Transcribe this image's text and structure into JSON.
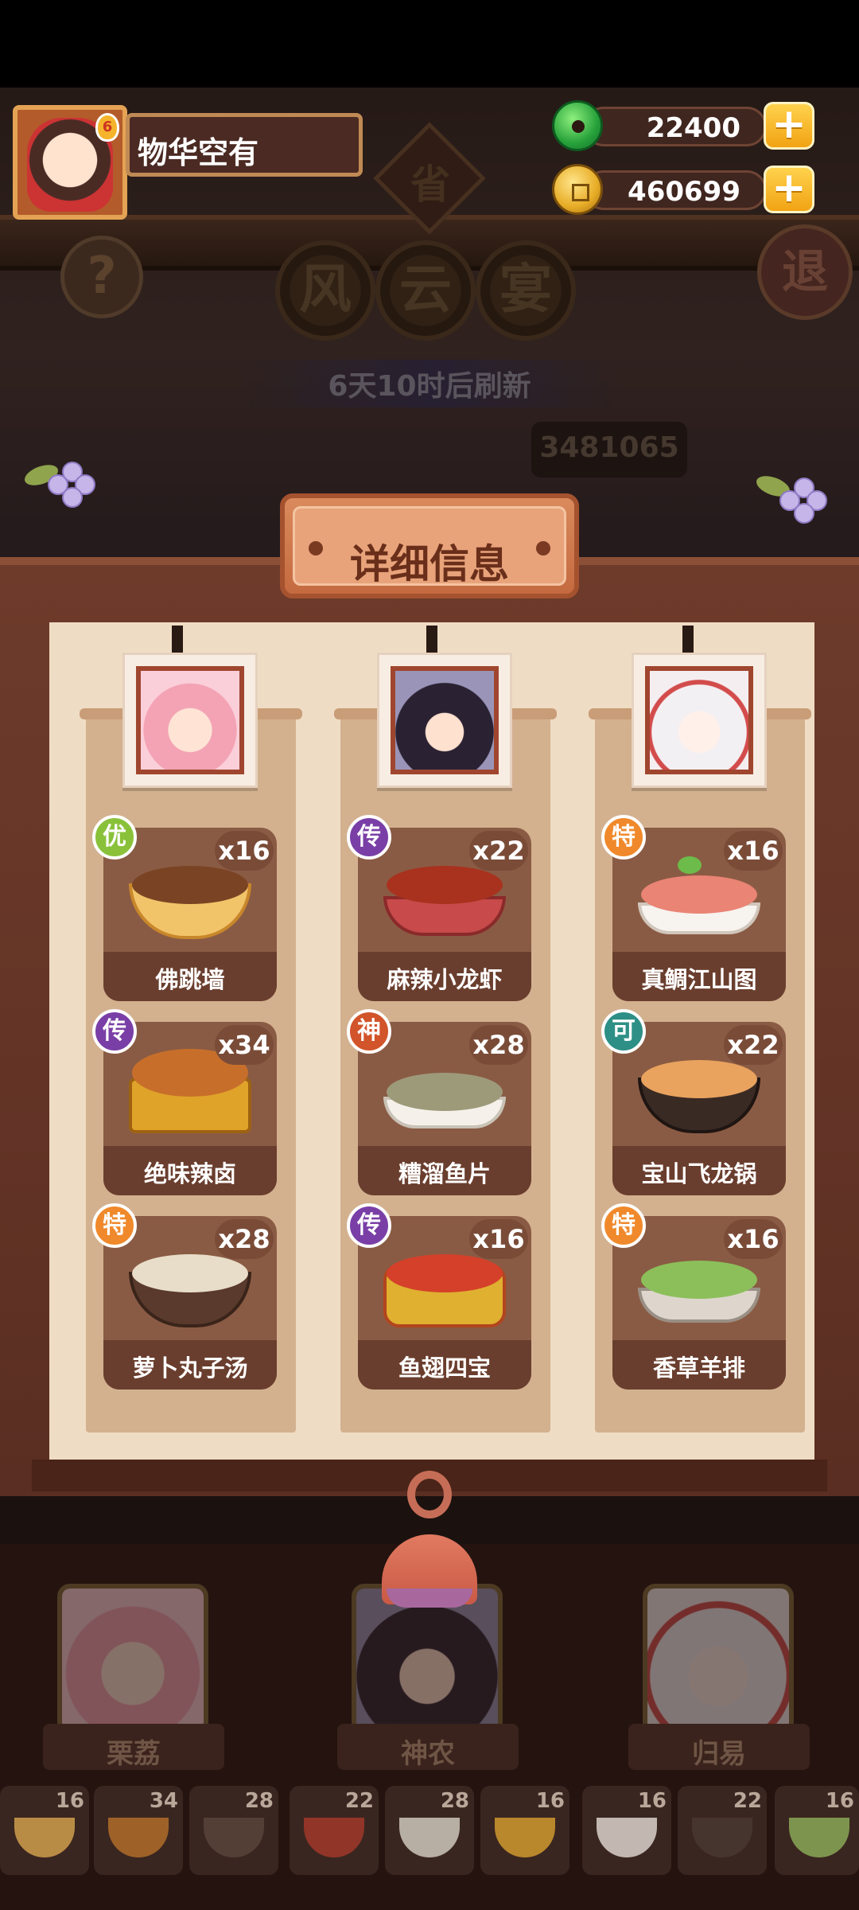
{
  "player": {
    "name": "物华空有",
    "avatar_badge": "6"
  },
  "currency": [
    {
      "icon": "jade-icon",
      "value": "22400"
    },
    {
      "icon": "coin-icon",
      "value": "460699"
    }
  ],
  "header": {
    "province": "省",
    "title_chars": [
      "风",
      "云",
      "宴"
    ],
    "refresh": "6天10时后刷新",
    "score": "3481065",
    "help": "?",
    "exit": "退"
  },
  "panel": {
    "title": "详细信息",
    "columns": [
      {
        "portrait": "pink-hair-character",
        "dishes": [
          {
            "grade": "优",
            "count": "x16",
            "name": "佛跳墙"
          },
          {
            "grade": "传",
            "count": "x34",
            "name": "绝味辣卤"
          },
          {
            "grade": "特",
            "count": "x28",
            "name": "萝卜丸子汤"
          }
        ]
      },
      {
        "portrait": "dark-hair-character",
        "dishes": [
          {
            "grade": "传",
            "count": "x22",
            "name": "麻辣小龙虾"
          },
          {
            "grade": "神",
            "count": "x28",
            "name": "糟溜鱼片"
          },
          {
            "grade": "传",
            "count": "x16",
            "name": "鱼翅四宝"
          }
        ]
      },
      {
        "portrait": "white-hair-character",
        "dishes": [
          {
            "grade": "特",
            "count": "x16",
            "name": "真鲷江山图"
          },
          {
            "grade": "可",
            "count": "x22",
            "name": "宝山飞龙锅"
          },
          {
            "grade": "特",
            "count": "x16",
            "name": "香草羊排"
          }
        ]
      }
    ]
  },
  "characters": [
    {
      "name": "栗荔"
    },
    {
      "name": "神农"
    },
    {
      "name": "归易"
    }
  ],
  "thumbnails": [
    "16",
    "34",
    "28",
    "22",
    "28",
    "16",
    "16",
    "22",
    "16"
  ],
  "colors": {
    "grade_you": "#8ac13a",
    "grade_chuan": "#7a3fa6",
    "grade_te": "#f0892b",
    "grade_shen": "#d2542a",
    "grade_ke": "#2e8f86"
  }
}
